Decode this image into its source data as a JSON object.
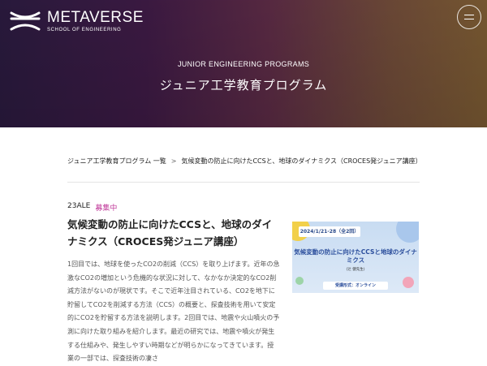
{
  "header": {
    "logo_title": "METAVERSE",
    "logo_subtitle": "SCHOOL OF ENGINEERING",
    "menu_icon": "hamburger-menu-icon"
  },
  "hero": {
    "subtitle_en": "JUNIOR ENGINEERING PROGRAMS",
    "title_jp": "ジュニア工学教育プログラム",
    "colors": {
      "gradient_start": "#2a1a3e",
      "gradient_mid": "#5a2a44",
      "gradient_end": "#7a5a32"
    }
  },
  "breadcrumb": {
    "parent": "ジュニア工学教育プログラム 一覧",
    "separator": ">",
    "current": "気候変動の防止に向けたCCSと、地球のダイナミクス（CROCES発ジュニア講座）"
  },
  "article": {
    "code": "23ALE",
    "status": "募集中",
    "status_color": "#c0399a",
    "title": "気候変動の防止に向けたCCSと、地球のダイナミクス（CROCES発ジュニア講座）",
    "body": "1回目では、地球を使ったCO2の削減（CCS）を取り上げます。近年の急激なCO2の増加という危機的な状況に対して、なかなか決定的なCO2削減方法がないのが現状です。そこで近年注目されている、CO2を地下に貯留してCO2を削減する方法（CCS）の概要と、探査技術を用いて安定的にCO2を貯留する方法を説明します。2回目では、地震や火山噴火の予測に向けた取り組みを紹介します。最近の研究では、地震や噴火が発生する仕組みや、発生しやすい時期などが明らかになってきています。授業の一部では、探査技術の凄さ"
  },
  "thumbnail": {
    "date": "2024/1/21-28（全2回）",
    "title": "気候変動の防止に向けたCCSと地球のダイナミクス",
    "teacher": "(辻 健先生)",
    "format": "受講形式：オンライン"
  }
}
